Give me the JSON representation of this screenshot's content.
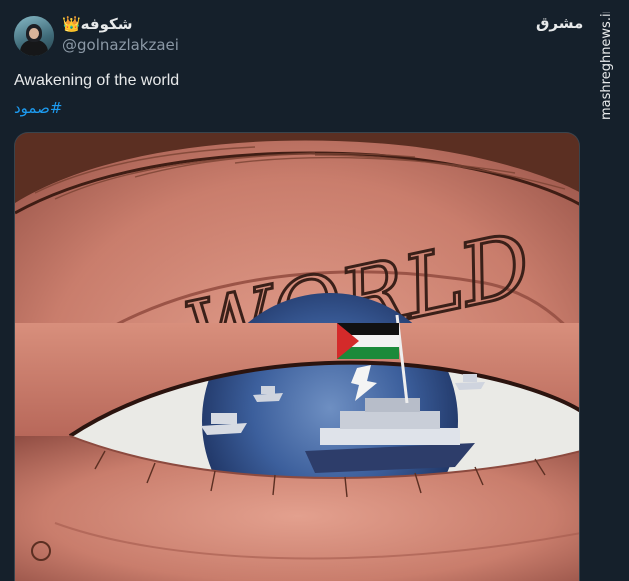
{
  "author": {
    "display_name": "شکوفه👑",
    "handle": "@golnazlakzaei",
    "avatar_icon": "profile-photo"
  },
  "source": {
    "logo_text": "مشرق",
    "logo_icon": "mashregh-logo-icon",
    "site": "mashreghnews.ir"
  },
  "tweet": {
    "text": "Awakening of the world",
    "hashtag": "#صمود"
  },
  "media": {
    "eyebrow_lettering": "WORLD",
    "illustration": "eye-reflecting-boats-with-palestinian-flag"
  },
  "colors": {
    "background": "#15202b",
    "text": "#e7e9ea",
    "secondary_text": "#8b98a5",
    "link": "#1d9bf0"
  }
}
